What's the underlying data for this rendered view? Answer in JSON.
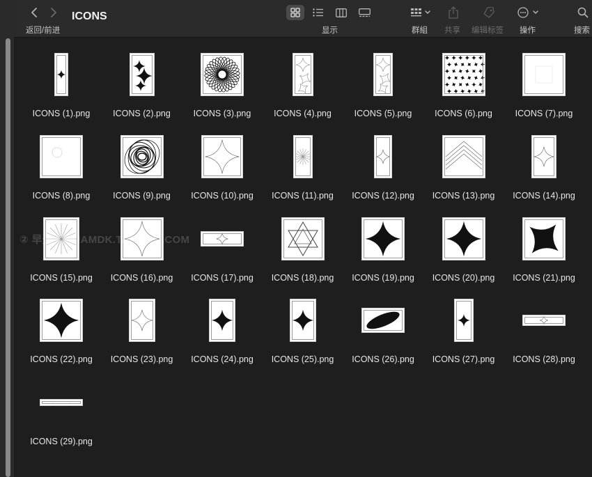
{
  "window": {
    "title": "ICONS"
  },
  "toolbar": {
    "back_forward_label": "返回/前进",
    "view_label": "显示",
    "group_label": "群組",
    "share_label": "共享",
    "edit_tags_label": "编辑标签",
    "action_label": "操作",
    "search_label": "搜索"
  },
  "watermark": "② 早道大咖  IAMDK.TAOBAO.COM",
  "files": [
    {
      "name": "ICONS (1).png",
      "icon": "thin-vertical-sparkle"
    },
    {
      "name": "ICONS (2).png",
      "icon": "multi-sparkles"
    },
    {
      "name": "ICONS (3).png",
      "icon": "spiral-lens"
    },
    {
      "name": "ICONS (4).png",
      "icon": "faint-sparkles"
    },
    {
      "name": "ICONS (5).png",
      "icon": "faint-sparkles"
    },
    {
      "name": "ICONS (6).png",
      "icon": "sparkle-pattern"
    },
    {
      "name": "ICONS (7).png",
      "icon": "blank-square"
    },
    {
      "name": "ICONS (8).png",
      "icon": "faint-circle"
    },
    {
      "name": "ICONS (9).png",
      "icon": "ink-spiral"
    },
    {
      "name": "ICONS (10).png",
      "icon": "outline-star"
    },
    {
      "name": "ICONS (11).png",
      "icon": "burst-lines"
    },
    {
      "name": "ICONS (12).png",
      "icon": "outline-star"
    },
    {
      "name": "ICONS (13).png",
      "icon": "chevrons"
    },
    {
      "name": "ICONS (14).png",
      "icon": "outline-star"
    },
    {
      "name": "ICONS (15).png",
      "icon": "burst-lines"
    },
    {
      "name": "ICONS (16).png",
      "icon": "outline-star"
    },
    {
      "name": "ICONS (17).png",
      "icon": "outline-star"
    },
    {
      "name": "ICONS (18).png",
      "icon": "hex-star"
    },
    {
      "name": "ICONS (19).png",
      "icon": "solid-star"
    },
    {
      "name": "ICONS (20).png",
      "icon": "solid-star"
    },
    {
      "name": "ICONS (21).png",
      "icon": "diagonal-star"
    },
    {
      "name": "ICONS (22).png",
      "icon": "solid-star"
    },
    {
      "name": "ICONS (23).png",
      "icon": "outline-star"
    },
    {
      "name": "ICONS (24).png",
      "icon": "solid-star"
    },
    {
      "name": "ICONS (25).png",
      "icon": "solid-star"
    },
    {
      "name": "ICONS (26).png",
      "icon": "ellipse"
    },
    {
      "name": "ICONS (27).png",
      "icon": "thin-vertical-sparkle"
    },
    {
      "name": "ICONS (28).png",
      "icon": "outline-star"
    },
    {
      "name": "ICONS (29).png",
      "icon": "blank-square"
    }
  ]
}
